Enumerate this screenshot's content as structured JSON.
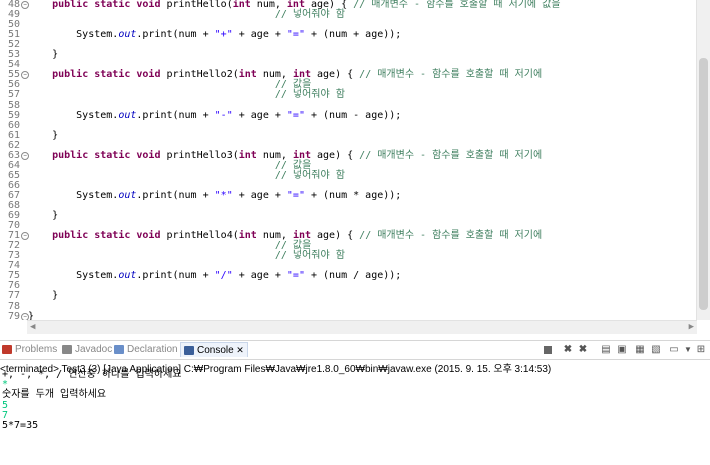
{
  "editor": {
    "lines": [
      {
        "n": "48",
        "fold": true,
        "parts": [
          [
            "",
            "    "
          ],
          [
            "kw",
            "public static void"
          ],
          [
            "",
            " printHello("
          ],
          [
            "kw",
            "int"
          ],
          [
            "",
            " num, "
          ],
          [
            "kw",
            "int"
          ],
          [
            "",
            " age) { "
          ],
          [
            "cm",
            "// 매개변수 - 함수를 호출할 때 저기에 값을"
          ]
        ]
      },
      {
        "n": "49",
        "parts": [
          [
            "",
            "                                         "
          ],
          [
            "cm",
            "// 넣어줘야 함"
          ]
        ]
      },
      {
        "n": "50",
        "parts": []
      },
      {
        "n": "51",
        "parts": [
          [
            "",
            "        System."
          ],
          [
            "fld",
            "out"
          ],
          [
            "",
            ".print(num + "
          ],
          [
            "str",
            "\"+\""
          ],
          [
            "",
            " + age + "
          ],
          [
            "str",
            "\"=\""
          ],
          [
            "",
            " + (num + age));"
          ]
        ]
      },
      {
        "n": "52",
        "parts": []
      },
      {
        "n": "53",
        "parts": [
          [
            "",
            "    }"
          ]
        ]
      },
      {
        "n": "54",
        "parts": []
      },
      {
        "n": "55",
        "fold": true,
        "parts": [
          [
            "",
            "    "
          ],
          [
            "kw",
            "public static void"
          ],
          [
            "",
            " printHello2("
          ],
          [
            "kw",
            "int"
          ],
          [
            "",
            " num, "
          ],
          [
            "kw",
            "int"
          ],
          [
            "",
            " age) { "
          ],
          [
            "cm",
            "// 매개변수 - 함수를 호출할 때 저기에"
          ]
        ]
      },
      {
        "n": "56",
        "parts": [
          [
            "",
            "                                         "
          ],
          [
            "cm",
            "// 값을"
          ]
        ]
      },
      {
        "n": "57",
        "parts": [
          [
            "",
            "                                         "
          ],
          [
            "cm",
            "// 넣어줘야 함"
          ]
        ]
      },
      {
        "n": "58",
        "parts": []
      },
      {
        "n": "59",
        "parts": [
          [
            "",
            "        System."
          ],
          [
            "fld",
            "out"
          ],
          [
            "",
            ".print(num + "
          ],
          [
            "str",
            "\"-\""
          ],
          [
            "",
            " + age + "
          ],
          [
            "str",
            "\"=\""
          ],
          [
            "",
            " + (num - age));"
          ]
        ]
      },
      {
        "n": "60",
        "parts": []
      },
      {
        "n": "61",
        "parts": [
          [
            "",
            "    }"
          ]
        ]
      },
      {
        "n": "62",
        "parts": []
      },
      {
        "n": "63",
        "fold": true,
        "parts": [
          [
            "",
            "    "
          ],
          [
            "kw",
            "public static void"
          ],
          [
            "",
            " printHello3("
          ],
          [
            "kw",
            "int"
          ],
          [
            "",
            " num, "
          ],
          [
            "kw",
            "int"
          ],
          [
            "",
            " age) { "
          ],
          [
            "cm",
            "// 매개변수 - 함수를 호출할 때 저기에"
          ]
        ]
      },
      {
        "n": "64",
        "parts": [
          [
            "",
            "                                         "
          ],
          [
            "cm",
            "// 값을"
          ]
        ]
      },
      {
        "n": "65",
        "parts": [
          [
            "",
            "                                         "
          ],
          [
            "cm",
            "// 넣어줘야 함"
          ]
        ]
      },
      {
        "n": "66",
        "parts": []
      },
      {
        "n": "67",
        "parts": [
          [
            "",
            "        System."
          ],
          [
            "fld",
            "out"
          ],
          [
            "",
            ".print(num + "
          ],
          [
            "str",
            "\"*\""
          ],
          [
            "",
            " + age + "
          ],
          [
            "str",
            "\"=\""
          ],
          [
            "",
            " + (num * age));"
          ]
        ]
      },
      {
        "n": "68",
        "parts": []
      },
      {
        "n": "69",
        "parts": [
          [
            "",
            "    }"
          ]
        ]
      },
      {
        "n": "70",
        "parts": []
      },
      {
        "n": "71",
        "fold": true,
        "parts": [
          [
            "",
            "    "
          ],
          [
            "kw",
            "public static void"
          ],
          [
            "",
            " printHello4("
          ],
          [
            "kw",
            "int"
          ],
          [
            "",
            " num, "
          ],
          [
            "kw",
            "int"
          ],
          [
            "",
            " age) { "
          ],
          [
            "cm",
            "// 매개변수 - 함수를 호출할 때 저기에"
          ]
        ]
      },
      {
        "n": "72",
        "parts": [
          [
            "",
            "                                         "
          ],
          [
            "cm",
            "// 값을"
          ]
        ]
      },
      {
        "n": "73",
        "parts": [
          [
            "",
            "                                         "
          ],
          [
            "cm",
            "// 넣어줘야 함"
          ]
        ]
      },
      {
        "n": "74",
        "parts": []
      },
      {
        "n": "75",
        "parts": [
          [
            "",
            "        System."
          ],
          [
            "fld",
            "out"
          ],
          [
            "",
            ".print(num + "
          ],
          [
            "str",
            "\"/\""
          ],
          [
            "",
            " + age + "
          ],
          [
            "str",
            "\"=\""
          ],
          [
            "",
            " + (num / age));"
          ]
        ]
      },
      {
        "n": "76",
        "parts": []
      },
      {
        "n": "77",
        "parts": [
          [
            "",
            "    }"
          ]
        ]
      },
      {
        "n": "78",
        "parts": []
      },
      {
        "n": "79",
        "fold": true,
        "parts": [
          [
            "",
            "}"
          ]
        ]
      },
      {
        "n": "80",
        "parts": []
      }
    ]
  },
  "tabs": [
    {
      "label": "Problems",
      "icon": "problems-icon",
      "color": "#c0392b",
      "active": false
    },
    {
      "label": "Javadoc",
      "icon": "javadoc-icon",
      "color": "#888888",
      "active": false
    },
    {
      "label": "Declaration",
      "icon": "declaration-icon",
      "color": "#6a8fc9",
      "active": false
    },
    {
      "label": "Console",
      "icon": "console-icon",
      "color": "#3b5f99",
      "active": true
    }
  ],
  "console": {
    "status": "<terminated> Test3 (3) [Java Application] C:₩Program Files₩Java₩jre1.8.0_60₩bin₩javaw.exe (2015. 9. 15. 오후 3:14:53)",
    "lines": [
      {
        "text": "+, -, *, / 연산중 하나를 입력하세요",
        "kind": "out"
      },
      {
        "text": "*",
        "kind": "in"
      },
      {
        "text": "숫자를 두개 입력하세요",
        "kind": "out"
      },
      {
        "text": "5",
        "kind": "in"
      },
      {
        "text": "7",
        "kind": "in"
      },
      {
        "text": "5*7=35",
        "kind": "out"
      }
    ]
  },
  "colors": {
    "keyword": "#7f0055",
    "string": "#2a00ff",
    "comment": "#3f7f5f",
    "field": "#0000c0",
    "console_input": "#00c87d"
  }
}
